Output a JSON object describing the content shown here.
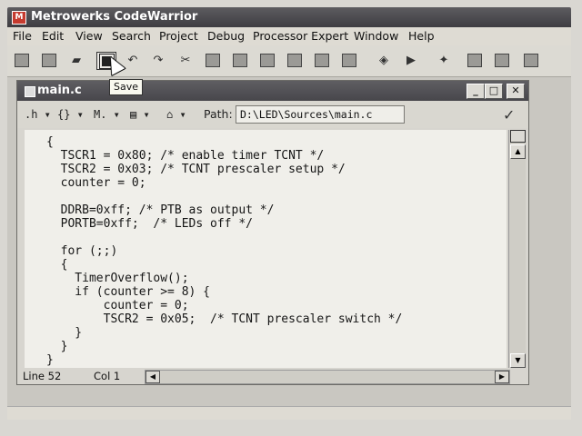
{
  "app": {
    "title": "Metrowerks CodeWarrior"
  },
  "menu": [
    "File",
    "Edit",
    "View",
    "Search",
    "Project",
    "Debug",
    "Processor Expert",
    "Window",
    "Help"
  ],
  "toolbar": {
    "tooltip": "Save"
  },
  "doc": {
    "title": "main.c",
    "path_label": "Path:",
    "path_value": "D:\\LED\\Sources\\main.c",
    "toolbar_menus": [
      ".h",
      "{}",
      "M.",
      "▤",
      "⌂"
    ]
  },
  "code": [
    "{",
    "  TSCR1 = 0x80; /* enable timer TCNT */",
    "  TSCR2 = 0x03; /* TCNT prescaler setup */",
    "  counter = 0;",
    "",
    "  DDRB=0xff; /* PTB as output */",
    "  PORTB=0xff;  /* LEDs off */",
    "",
    "  for (;;)",
    "  {",
    "    TimerOverflow();",
    "    if (counter >= 8) {",
    "        counter = 0;",
    "        TSCR2 = 0x05;  /* TCNT prescaler switch */",
    "    }",
    "  }",
    "}"
  ],
  "status": {
    "line": "Line 52",
    "col": "Col 1"
  }
}
